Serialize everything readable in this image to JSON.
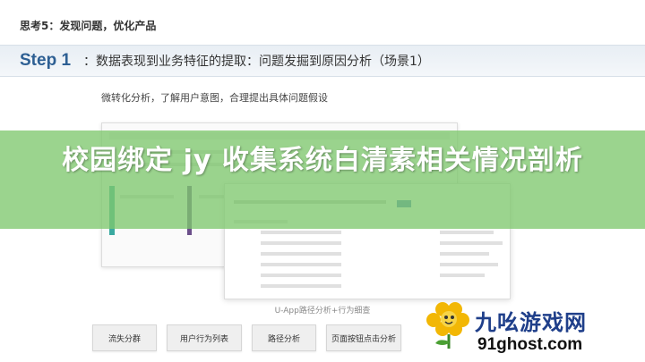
{
  "header": {
    "title": "思考5：发现问题，优化产品"
  },
  "step": {
    "label": "Step 1",
    "text": "：数据表现到业务特征的提取：问题发掘到原因分析（场景1）"
  },
  "content": {
    "subtitle": "微转化分析，了解用户意图，合理提出具体问题假设",
    "caption": "U-App路径分析+行为细查"
  },
  "buttons": [
    {
      "label": "流失分群"
    },
    {
      "label": "用户行为列表"
    },
    {
      "label": "路径分析"
    },
    {
      "label": "页面按钮点击分析"
    }
  ],
  "overlay": {
    "title": "校园绑定 jy 收集系统白清素相关情况剖析"
  },
  "watermark": {
    "name": "九吆游戏网",
    "url": "91ghost.com"
  },
  "colors": {
    "step_accent": "#2d5f93",
    "overlay_green": "#7fc86e",
    "watermark_blue": "#1f3f8a"
  }
}
